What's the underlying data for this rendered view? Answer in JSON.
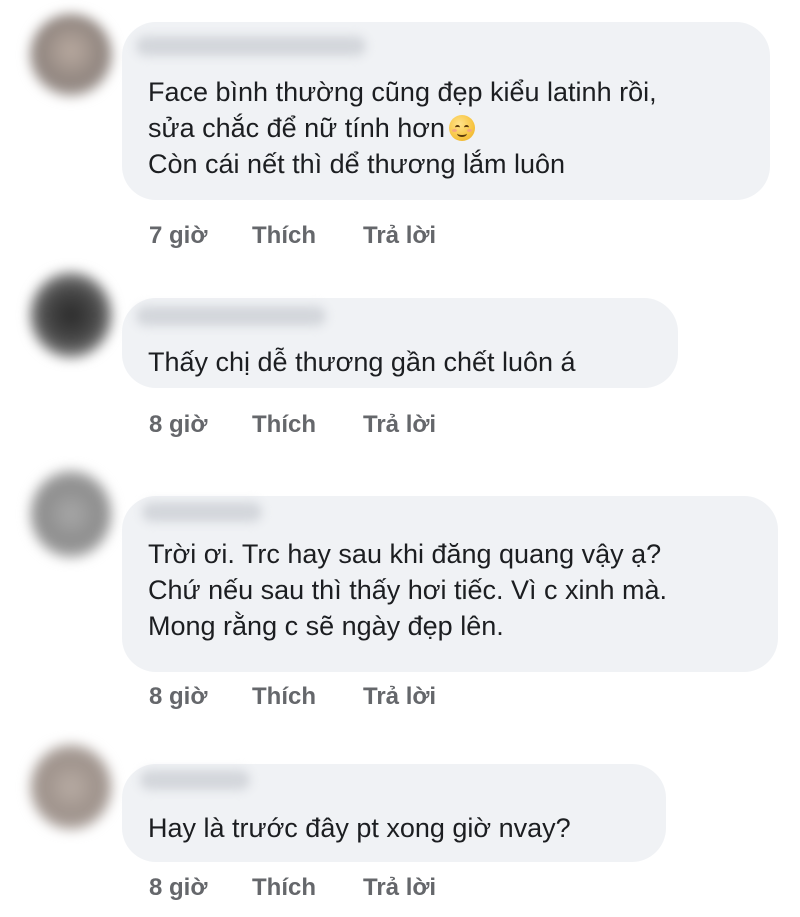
{
  "comments": [
    {
      "lines": [
        "Face bình thường cũng đẹp kiểu latinh rồi,",
        "sửa chắc để nữ tính hơn",
        "Còn cái nết thì dể thương lắm luôn"
      ],
      "emoji": "smiling-face-with-smiling-eyes",
      "time": "7 giờ",
      "like": "Thích",
      "reply": "Trả lời"
    },
    {
      "lines": [
        "Thấy chị dễ thương gần chết luôn á"
      ],
      "time": "8 giờ",
      "like": "Thích",
      "reply": "Trả lời"
    },
    {
      "lines": [
        "Trời ơi. Trc hay sau khi đăng quang vậy ạ?",
        "Chứ nếu sau thì thấy hơi tiếc. Vì c xinh mà.",
        "Mong rằng c sẽ ngày đẹp lên."
      ],
      "time": "8 giờ",
      "like": "Thích",
      "reply": "Trả lời"
    },
    {
      "lines": [
        "Hay là trước đây pt xong giờ nvay?"
      ],
      "time": "8 giờ",
      "like": "Thích",
      "reply": "Trả lời"
    }
  ]
}
